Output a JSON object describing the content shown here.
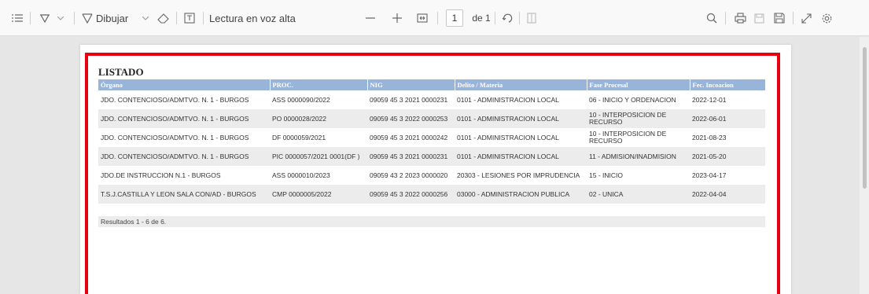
{
  "toolbar": {
    "draw_label": "Dibujar",
    "read_aloud_label": "Lectura en voz alta",
    "page_number": "1",
    "page_of": "de 1"
  },
  "document": {
    "title": "LISTADO",
    "columns": [
      "Órgano",
      "PROC.",
      "NIG",
      "Delito / Materia",
      "Fase Procesal",
      "Fec. Incoacion"
    ],
    "rows": [
      [
        "JDO. CONTENCIOSO/ADMTVO. N. 1 - BURGOS",
        "ASS 0000090/2022",
        "09059 45 3 2021 0000231",
        "0101 - ADMINISTRACION LOCAL",
        "06 - INICIO Y ORDENACION",
        "2022-12-01"
      ],
      [
        "JDO. CONTENCIOSO/ADMTVO. N. 1 - BURGOS",
        "PO 0000028/2022",
        "09059 45 3 2022 0000253",
        "0101 - ADMINISTRACION LOCAL",
        "10 - INTERPOSICION DE RECURSO",
        "2022-06-01"
      ],
      [
        "JDO. CONTENCIOSO/ADMTVO. N. 1 - BURGOS",
        "DF 0000059/2021",
        "09059 45 3 2021 0000242",
        "0101 - ADMINISTRACION LOCAL",
        "10 - INTERPOSICION DE RECURSO",
        "2021-08-23"
      ],
      [
        "JDO. CONTENCIOSO/ADMTVO. N. 1 - BURGOS",
        "PIC 0000057/2021 0001(DF )",
        "09059 45 3 2021 0000231",
        "0101 - ADMINISTRACION LOCAL",
        "11 - ADMISION/INADMISION",
        "2021-05-20"
      ],
      [
        "JDO.DE INSTRUCCION N.1 - BURGOS",
        "ASS 0000010/2023",
        "09059 43 2 2023 0000020",
        "20303 - LESIONES POR IMPRUDENCIA",
        "15 - INICIO",
        "2023-04-17"
      ],
      [
        "T.S.J.CASTILLA Y LEON SALA CON/AD - BURGOS",
        "CMP 0000005/2022",
        "09059 45 3 2022 0000256",
        "03000 - ADMINISTRACION PUBLICA",
        "02 - UNICA",
        "2022-04-04"
      ]
    ],
    "results_text": "Resultados 1 - 6 de 6."
  },
  "colors": {
    "header_bg": "#98b4d8",
    "highlight_border": "#e8000f"
  }
}
